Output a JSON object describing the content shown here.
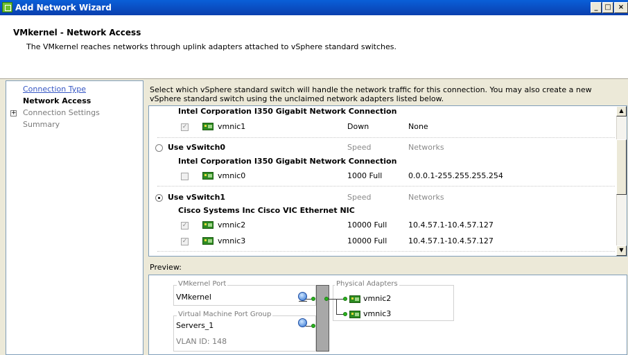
{
  "window": {
    "title": "Add Network Wizard",
    "buttons": [
      "_",
      "□",
      "×"
    ]
  },
  "header": {
    "title": "VMkernel - Network Access",
    "description": "The VMkernel reaches networks through uplink adapters attached to vSphere standard switches."
  },
  "nav": {
    "items": [
      {
        "label": "Connection Type",
        "state": "link"
      },
      {
        "label": "Network Access",
        "state": "current"
      },
      {
        "label": "Connection Settings",
        "state": "grey",
        "expander": "+"
      },
      {
        "label": "Summary",
        "state": "grey"
      }
    ]
  },
  "instruction": "Select which vSphere standard switch will handle the network traffic for this connection. You may also create a new vSphere standard switch using the unclaimed network adapters listed below.",
  "switch_list": {
    "top_partial": {
      "nic_title": "Intel Corporation I350 Gigabit Network Connection",
      "nic": {
        "name": "vmnic1",
        "speed": "Down",
        "networks": "None",
        "checked": true,
        "enabled": false
      }
    },
    "switches": [
      {
        "label": "Use vSwitch0",
        "selected": false,
        "speed_header": "Speed",
        "networks_header": "Networks",
        "nic_title": "Intel Corporation I350 Gigabit Network Connection",
        "nics": [
          {
            "name": "vmnic0",
            "speed": "1000 Full",
            "networks": "0.0.0.1-255.255.255.254",
            "checked": false
          }
        ]
      },
      {
        "label": "Use vSwitch1",
        "selected": true,
        "speed_header": "Speed",
        "networks_header": "Networks",
        "nic_title": "Cisco Systems Inc Cisco VIC Ethernet NIC",
        "nics": [
          {
            "name": "vmnic2",
            "speed": "10000 Full",
            "networks": "10.4.57.1-10.4.57.127",
            "checked": true
          },
          {
            "name": "vmnic3",
            "speed": "10000 Full",
            "networks": "10.4.57.1-10.4.57.127",
            "checked": true
          }
        ]
      }
    ]
  },
  "preview": {
    "label": "Preview:",
    "vmkernel_group_title": "VMkernel Port",
    "vmkernel_name": "VMkernel",
    "vm_group_title": "Virtual Machine Port Group",
    "vm_group_name": "Servers_1",
    "vlan": "VLAN ID: 148",
    "physical_title": "Physical Adapters",
    "physical": [
      "vmnic2",
      "vmnic3"
    ]
  },
  "colors": {
    "titlebar": "#0a4fc4",
    "link": "#3556c4",
    "nic_icon": "#2e8b22",
    "link_dot": "#29b31d"
  }
}
